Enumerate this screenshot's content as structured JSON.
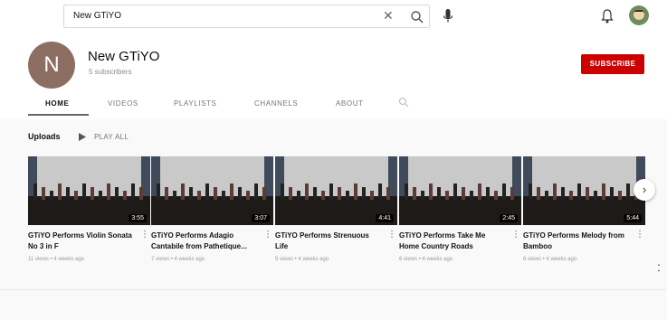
{
  "search": {
    "query": "New GTiYO",
    "clear_icon": "close-icon"
  },
  "channel": {
    "avatar_letter": "N",
    "name": "New GTiYO",
    "subscribers": "5 subscribers",
    "subscribe_label": "SUBSCRIBE"
  },
  "tabs": [
    {
      "label": "HOME"
    },
    {
      "label": "VIDEOS"
    },
    {
      "label": "PLAYLISTS"
    },
    {
      "label": "CHANNELS"
    },
    {
      "label": "ABOUT"
    }
  ],
  "uploads": {
    "label": "Uploads",
    "play_all": "PLAY ALL"
  },
  "videos": [
    {
      "title": "GTiYO Performs Violin Sonata No 3 in F",
      "duration": "3:55",
      "meta": "11 views • 4 weeks ago"
    },
    {
      "title": "GTiYO Performs Adagio Cantabile from Pathetique...",
      "duration": "3:07",
      "meta": "7 views • 4 weeks ago"
    },
    {
      "title": "GTiYO Performs Strenuous Life",
      "duration": "4:41",
      "meta": "5 views • 4 weeks ago"
    },
    {
      "title": "GTiYO Performs Take Me Home Country Roads",
      "duration": "2:45",
      "meta": "6 views • 4 weeks ago"
    },
    {
      "title": "GTiYO Performs Melody from Bamboo",
      "duration": "5:44",
      "meta": "6 views • 4 weeks ago"
    }
  ],
  "colors": {
    "subscribe": "#cc0000",
    "avatar": "#8d6e63"
  },
  "icons": [
    "search-icon",
    "microphone-icon",
    "bell-icon",
    "play-icon",
    "chevron-right-icon",
    "kebab-icon"
  ]
}
